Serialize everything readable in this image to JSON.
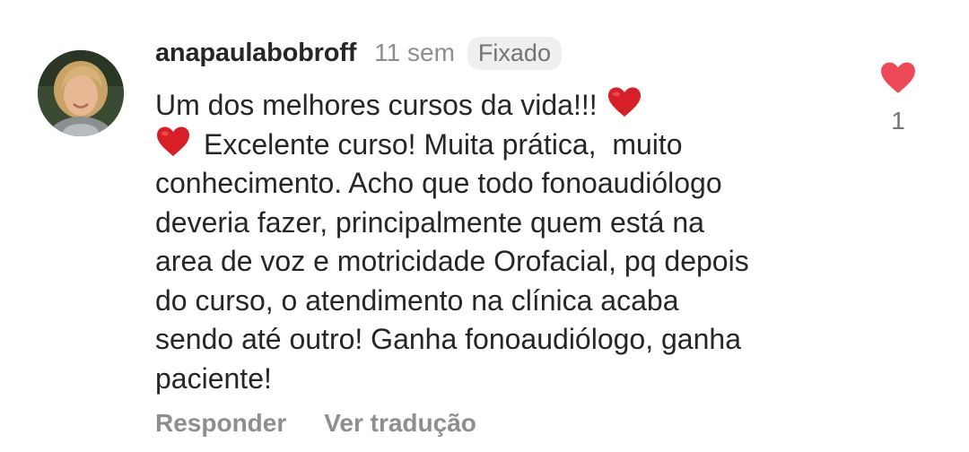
{
  "comment": {
    "username": "anapaulabobroff",
    "time_ago": "11 sem",
    "pinned_label": "Fixado",
    "text_lines": [
      "Um dos melhores cursos da vida!!!",
      "Excelente curso! Muita prática,  muito",
      "conhecimento. Acho que todo fonoaudiólogo",
      "deveria fazer, principalmente quem está na",
      "area de voz e motricidade Orofacial, pq depois",
      "do curso, o atendimento na clínica acaba",
      "sendo até outro! Ganha fonoaudiólogo, ganha",
      "paciente!"
    ],
    "inline_emoji": "red-heart-icon",
    "like_count": "1",
    "like_icon": "heart-filled-icon",
    "actions": {
      "reply_label": "Responder",
      "translate_label": "Ver tradução"
    }
  },
  "colors": {
    "heart": "#ed4956",
    "emoji_heart": "#d61f26",
    "primary_text": "#262626",
    "secondary_text": "#8e8e8e",
    "badge_bg": "#efefef"
  }
}
